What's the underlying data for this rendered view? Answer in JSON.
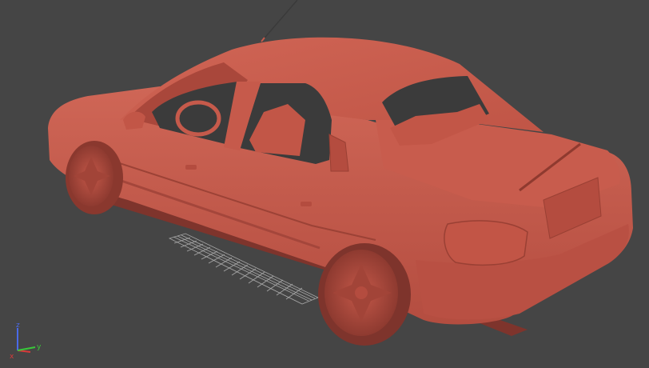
{
  "viewport": {
    "background": "#454545",
    "model_color": "#c65a4b",
    "model_shadow": "#a8463a",
    "model_highlight": "#d87262",
    "grid_color": "#b8b8b8"
  },
  "gizmo": {
    "axis_x": {
      "label": "x",
      "color": "#d83a3a"
    },
    "axis_y": {
      "label": "y",
      "color": "#3ac83a"
    },
    "axis_z": {
      "label": "z",
      "color": "#4a6ae8"
    }
  }
}
